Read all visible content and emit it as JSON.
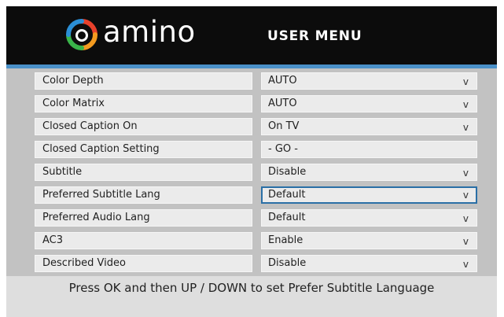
{
  "header": {
    "brand": "amino",
    "title": "USER MENU"
  },
  "menu": [
    {
      "label": "Color Depth",
      "value": "AUTO",
      "arrow": "v"
    },
    {
      "label": "Color Matrix",
      "value": "AUTO",
      "arrow": "v"
    },
    {
      "label": "Closed Caption On",
      "value": "On TV",
      "arrow": "v"
    },
    {
      "label": "Closed Caption Setting",
      "value": "- GO -",
      "arrow": ""
    },
    {
      "label": "Subtitle",
      "value": "Disable",
      "arrow": "v"
    },
    {
      "label": "Preferred Subtitle Lang",
      "value": "Default",
      "arrow": "v"
    },
    {
      "label": "Preferred Audio Lang",
      "value": "Default",
      "arrow": "v"
    },
    {
      "label": "AC3",
      "value": "Enable",
      "arrow": "v"
    },
    {
      "label": "Described Video",
      "value": "Disable",
      "arrow": "v"
    }
  ],
  "footer": {
    "hint": "Press OK and then UP / DOWN to set Prefer Subtitle Language"
  },
  "colors": {
    "header_bg": "#0c0c0c",
    "accent_blue": "#4a90c8",
    "selection_border": "#2a6fa6"
  }
}
